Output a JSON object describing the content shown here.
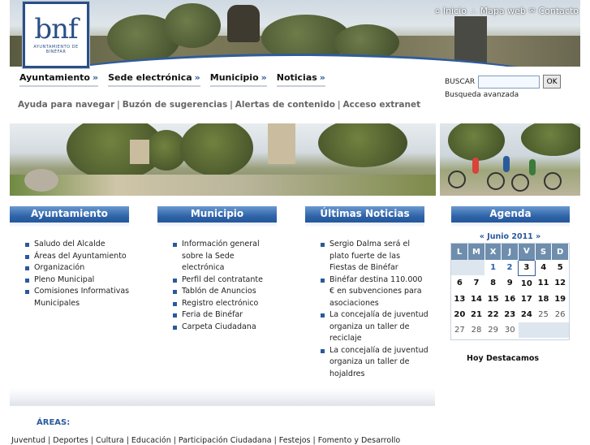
{
  "header": {
    "logo_mark": "bnf",
    "logo_sub": "AYUNTAMIENTO DE BINÉFAR",
    "top_links": [
      "Inicio",
      "Mapa web",
      "Contacto"
    ],
    "top_link_separator": ".:."
  },
  "nav": {
    "main": [
      "Ayuntamiento",
      "Sede electrónica",
      "Municipio",
      "Noticias"
    ],
    "arrow": "»",
    "secondary": [
      "Ayuda para navegar",
      "Buzón de sugerencias",
      "Alertas de contenido",
      "Acceso extranet"
    ],
    "separator": "|"
  },
  "search": {
    "label": "BUSCAR",
    "button": "OK",
    "value": "",
    "advanced": "Busqueda avanzada"
  },
  "sections": {
    "ayuntamiento": {
      "title": "Ayuntamiento",
      "items": [
        "Saludo del Alcalde",
        "Áreas del Ayuntamiento",
        "Organización",
        "Pleno Municipal",
        "Comisiones Informativas Municipales"
      ]
    },
    "municipio": {
      "title": "Municipio",
      "items": [
        "Información general sobre la Sede electrónica",
        "Perfil del contratante",
        "Tablón de Anuncios",
        "Registro electrónico",
        "Feria de Binéfar",
        "Carpeta Ciudadana"
      ]
    },
    "noticias": {
      "title": "Últimas Noticias",
      "items": [
        "Sergio Dalma será el plato fuerte de las Fiestas de Binéfar",
        "Binéfar destina 110.000 € en subvenciones para asociaciones",
        "La concejalía de juventud organiza un taller de reciclaje",
        "La concejalía de juventud organiza un taller de hojaldres"
      ]
    },
    "agenda": {
      "title": "Agenda",
      "month": "« Junio 2011 »",
      "weekdays": [
        "L",
        "M",
        "X",
        "J",
        "V",
        "S",
        "D"
      ],
      "weeks": [
        [
          "",
          "",
          "1",
          "2",
          "3",
          "4",
          "5"
        ],
        [
          "6",
          "7",
          "8",
          "9",
          "10",
          "11",
          "12"
        ],
        [
          "13",
          "14",
          "15",
          "16",
          "17",
          "18",
          "19"
        ],
        [
          "20",
          "21",
          "22",
          "23",
          "24",
          "25",
          "26"
        ],
        [
          "27",
          "28",
          "29",
          "30",
          "",
          "",
          ""
        ]
      ],
      "highlight": "Hoy Destacamos"
    }
  },
  "areas": {
    "title": "ÁREAS:",
    "items": [
      "Juventud",
      "Deportes",
      "Cultura",
      "Educación",
      "Participación Ciudadana",
      "Festejos",
      "Fomento y Desarrollo"
    ]
  },
  "colors": {
    "accent": "#2a5a9c",
    "header_gradient_top": "#6a99d0",
    "header_gradient_bottom": "#1d4d8e",
    "calendar_weekday_bg": "#6f8eae"
  }
}
